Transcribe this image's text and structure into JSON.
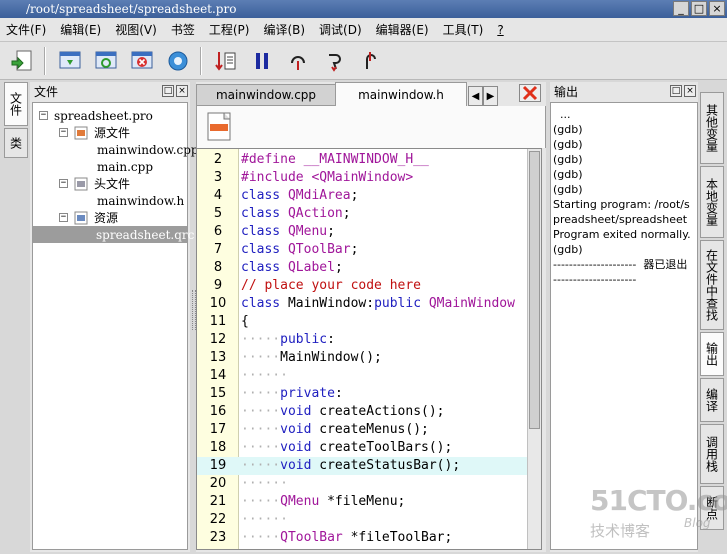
{
  "window": {
    "title": "/root/spreadsheet/spreadsheet.pro",
    "buttons": [
      "_",
      "□",
      "×"
    ]
  },
  "menu": [
    "文件(F)",
    "编辑(E)",
    "视图(V)",
    "书签",
    "工程(P)",
    "编译(B)",
    "调试(D)",
    "编辑器(E)",
    "工具(T)",
    "?"
  ],
  "toolbar": {
    "icons": [
      "new-project-icon",
      "open-file-icon",
      "reload-icon",
      "close-project-icon",
      "configure-icon",
      "build-icon",
      "pause-icon",
      "step-over-icon",
      "step-into-icon",
      "step-out-icon"
    ]
  },
  "left_tabs": [
    "文件",
    "类"
  ],
  "file_panel": {
    "title": "文件",
    "tree": [
      {
        "label": "spreadsheet.pro",
        "level": 0,
        "expander": "−"
      },
      {
        "label": "源文件",
        "level": 1,
        "expander": "−",
        "folder": true
      },
      {
        "label": "mainwindow.cpp",
        "level": 2
      },
      {
        "label": "main.cpp",
        "level": 2
      },
      {
        "label": "头文件",
        "level": 1,
        "expander": "−",
        "folder": true
      },
      {
        "label": "mainwindow.h",
        "level": 2
      },
      {
        "label": "资源",
        "level": 1,
        "expander": "−",
        "folder": true
      },
      {
        "label": "spreadsheet.qrc",
        "level": 2,
        "selected": true
      }
    ]
  },
  "editor": {
    "tabs": [
      "mainwindow.cpp",
      "mainwindow.h"
    ],
    "active_tab": 1,
    "arrows": [
      "◀",
      "▶"
    ],
    "current_line": 19,
    "lines": [
      {
        "n": "2",
        "tokens": [
          [
            "#define __MAINWINDOW_H__",
            "mag"
          ]
        ]
      },
      {
        "n": "3",
        "tokens": [
          [
            "#include <QMainWindow>",
            "mag"
          ]
        ]
      },
      {
        "n": "4",
        "tokens": [
          [
            "class",
            "blue"
          ],
          [
            " ",
            ""
          ],
          [
            "QMdiArea",
            "mag"
          ],
          [
            ";",
            "txt"
          ]
        ]
      },
      {
        "n": "5",
        "tokens": [
          [
            "class",
            "blue"
          ],
          [
            " ",
            ""
          ],
          [
            "QAction",
            "mag"
          ],
          [
            ";",
            "txt"
          ]
        ]
      },
      {
        "n": "6",
        "tokens": [
          [
            "class",
            "blue"
          ],
          [
            " ",
            ""
          ],
          [
            "QMenu",
            "mag"
          ],
          [
            ";",
            "txt"
          ]
        ]
      },
      {
        "n": "7",
        "tokens": [
          [
            "class",
            "blue"
          ],
          [
            " ",
            ""
          ],
          [
            "QToolBar",
            "mag"
          ],
          [
            ";",
            "txt"
          ]
        ]
      },
      {
        "n": "8",
        "tokens": [
          [
            "class",
            "blue"
          ],
          [
            " ",
            ""
          ],
          [
            "QLabel",
            "mag"
          ],
          [
            ";",
            "txt"
          ]
        ]
      },
      {
        "n": "9",
        "tokens": [
          [
            "// place your code here",
            "red"
          ]
        ]
      },
      {
        "n": "10",
        "tokens": [
          [
            "class",
            "blue"
          ],
          [
            " MainWindow:",
            "txt"
          ],
          [
            "public",
            "blue"
          ],
          [
            " ",
            ""
          ],
          [
            "QMainWindow",
            "mag"
          ]
        ]
      },
      {
        "n": "11",
        "tokens": [
          [
            "{",
            "txt"
          ]
        ]
      },
      {
        "n": "12",
        "tokens": [
          [
            "·····",
            "ws"
          ],
          [
            "public",
            "blue"
          ],
          [
            ":",
            "txt"
          ]
        ]
      },
      {
        "n": "13",
        "tokens": [
          [
            "·····",
            "ws"
          ],
          [
            "MainWindow();",
            "txt"
          ]
        ]
      },
      {
        "n": "14",
        "tokens": [
          [
            "······",
            "ws"
          ]
        ]
      },
      {
        "n": "15",
        "tokens": [
          [
            "·····",
            "ws"
          ],
          [
            "private",
            "blue"
          ],
          [
            ":",
            "txt"
          ]
        ]
      },
      {
        "n": "16",
        "tokens": [
          [
            "·····",
            "ws"
          ],
          [
            "void",
            "blue"
          ],
          [
            " createActions();",
            "txt"
          ]
        ]
      },
      {
        "n": "17",
        "tokens": [
          [
            "·····",
            "ws"
          ],
          [
            "void",
            "blue"
          ],
          [
            " createMenus();",
            "txt"
          ]
        ]
      },
      {
        "n": "18",
        "tokens": [
          [
            "·····",
            "ws"
          ],
          [
            "void",
            "blue"
          ],
          [
            " createToolBars();",
            "txt"
          ]
        ]
      },
      {
        "n": "19",
        "tokens": [
          [
            "·····",
            "ws"
          ],
          [
            "void",
            "blue"
          ],
          [
            " createStatusBar();",
            "txt"
          ]
        ]
      },
      {
        "n": "20",
        "tokens": [
          [
            "······",
            "ws"
          ]
        ]
      },
      {
        "n": "21",
        "tokens": [
          [
            "·····",
            "ws"
          ],
          [
            "QMenu",
            "mag"
          ],
          [
            " *fileMenu;",
            "txt"
          ]
        ]
      },
      {
        "n": "22",
        "tokens": [
          [
            "······",
            "ws"
          ]
        ]
      },
      {
        "n": "23",
        "tokens": [
          [
            "·····",
            "ws"
          ],
          [
            "QToolBar",
            "mag"
          ],
          [
            " *fileToolBar;",
            "txt"
          ]
        ]
      }
    ]
  },
  "output_panel": {
    "title": "输出",
    "lines": [
      "  ...",
      "(gdb)",
      "(gdb)",
      "(gdb)",
      "(gdb)",
      "(gdb)",
      "Starting program: /root/spreadsheet/spreadsheet",
      "Program exited normally.",
      "(gdb)",
      "---------------------  器已退出",
      "---------------------"
    ]
  },
  "right_tabs": [
    "其他变量",
    "本地变量",
    "在文件中查找",
    "输出",
    "编译",
    "调用栈",
    "断点"
  ],
  "right_active": 3,
  "watermark": {
    "big": "51CTO.com",
    "small": "技术博客",
    "blog": "Blog"
  }
}
